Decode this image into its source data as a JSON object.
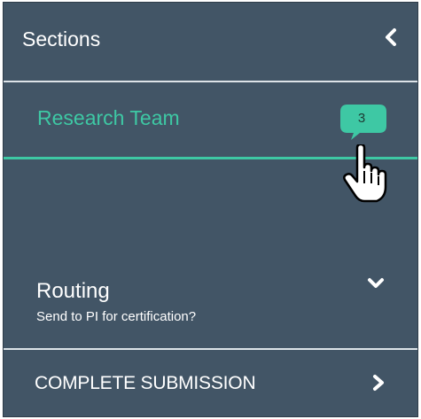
{
  "header": {
    "title": "Sections",
    "collapse_icon": "chevron-left-icon"
  },
  "sections": {
    "research_team": {
      "label": "Research Team",
      "badge_count": "3",
      "active": true
    },
    "routing": {
      "title": "Routing",
      "subtitle": "Send to PI for certification?",
      "icon": "chevron-down-icon"
    },
    "complete_submission": {
      "label": "COMPLETE SUBMISSION",
      "icon": "chevron-right-icon"
    }
  },
  "colors": {
    "panel_bg": "#425566",
    "accent": "#3ec8a4",
    "divider": "#dde3e8",
    "text": "#ffffff"
  }
}
